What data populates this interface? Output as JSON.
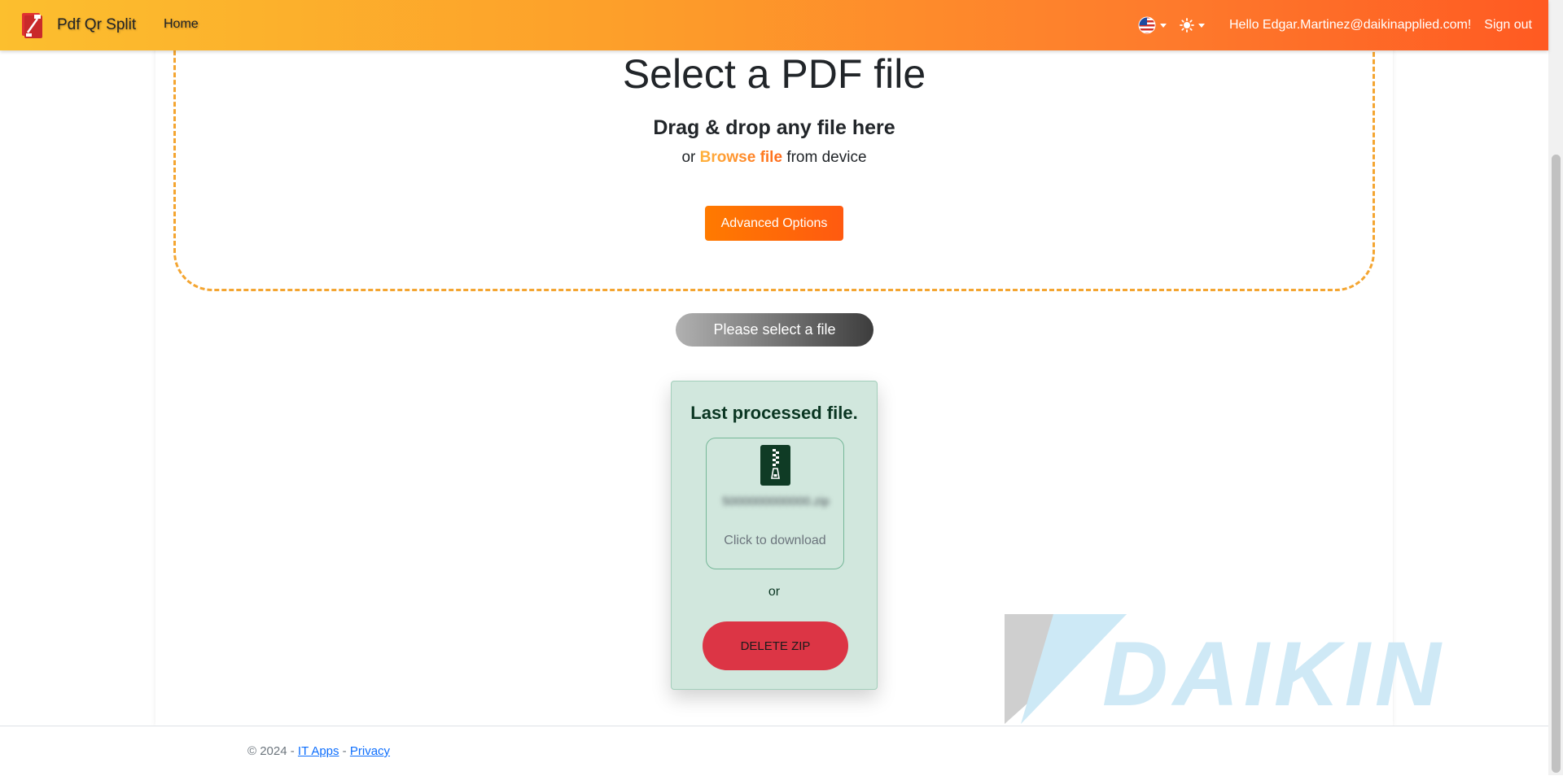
{
  "navbar": {
    "brand": "Pdf Qr Split",
    "home": "Home",
    "greeting": "Hello Edgar.Martinez@daikinapplied.com!",
    "sign_out": "Sign out",
    "language_icon": "us-flag-icon",
    "theme_icon": "sun-icon"
  },
  "dropzone": {
    "title": "Select a PDF file",
    "subtitle": "Drag & drop any file here",
    "or_text": "or",
    "browse_label": "Browse file",
    "from_device": "from device",
    "advanced_options": "Advanced Options"
  },
  "status_button": "Please select a file",
  "last_processed": {
    "title": "Last processed file.",
    "file_name": "5000000000000.zip",
    "click_to_download": "Click to download",
    "or_text": "or",
    "delete_label": "DELETE ZIP"
  },
  "watermark": {
    "text": "DAIKIN"
  },
  "footer": {
    "copyright": "© 2024 - ",
    "link_it_apps": "IT Apps",
    "separator": " - ",
    "link_privacy": "Privacy"
  },
  "colors": {
    "accent_orange": "#ff7a00",
    "danger": "#dc3545",
    "success_bg": "#d1e7dd",
    "dashed_border": "#f4a531"
  }
}
